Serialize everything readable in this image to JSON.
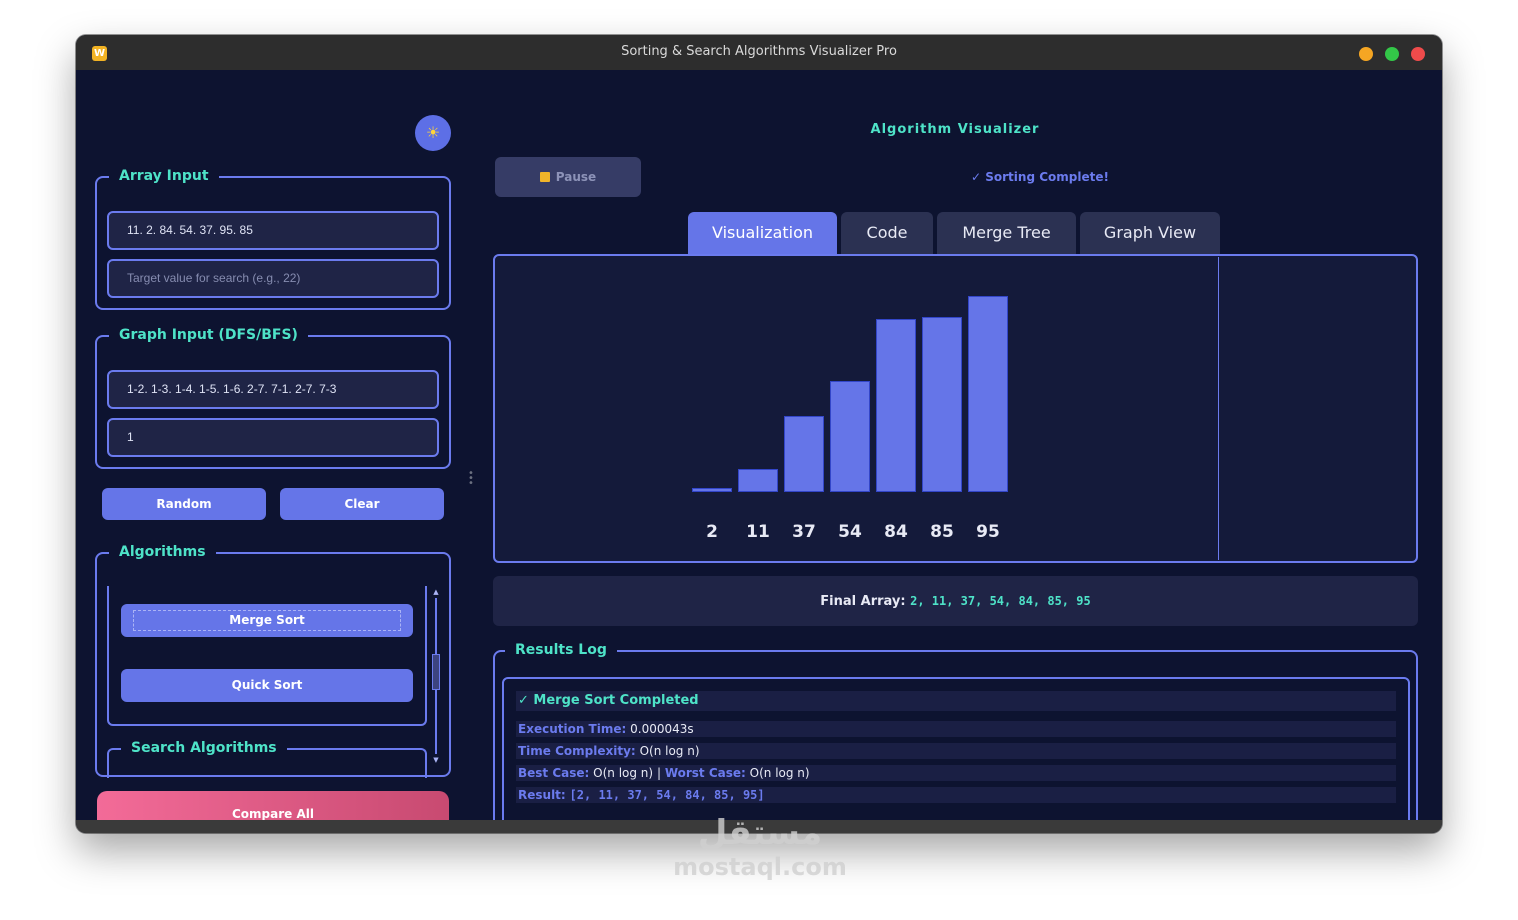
{
  "window": {
    "title": "Sorting & Search Algorithms Visualizer Pro",
    "app_icon_letter": "W"
  },
  "sidebar": {
    "theme_icon": "sun-icon",
    "array_input": {
      "title": "Array Input",
      "array_value": "11. 2. 84. 54. 37. 95. 85",
      "target_placeholder": "Target value for search (e.g., 22)"
    },
    "graph_input": {
      "title": "Graph Input (DFS/BFS)",
      "edges_value": "1-2. 1-3. 1-4. 1-5. 1-6. 2-7. 7-1. 2-7. 7-3",
      "start_value": "1"
    },
    "random_label": "Random",
    "clear_label": "Clear",
    "algorithms": {
      "title": "Algorithms",
      "items": [
        "Merge Sort",
        "Quick Sort"
      ],
      "search_title": "Search Algorithms"
    },
    "compare_label": "Compare All"
  },
  "main": {
    "title": "Algorithm Visualizer",
    "pause_label": "Pause",
    "status": "✓ Sorting Complete!",
    "tabs": [
      "Visualization",
      "Code",
      "Merge Tree",
      "Graph View"
    ],
    "active_tab": "Visualization",
    "final_label": "Final Array:",
    "final_values": "2, 11, 37, 54, 84, 85, 95"
  },
  "chart_data": {
    "type": "bar",
    "categories": [
      "2",
      "11",
      "37",
      "54",
      "84",
      "85",
      "95"
    ],
    "values": [
      2,
      11,
      37,
      54,
      84,
      85,
      95
    ]
  },
  "results": {
    "title": "Results Log",
    "heading": "✓ Merge Sort Completed",
    "execution_label": "Execution Time:",
    "execution_value": "0.000043s",
    "complexity_label": "Time Complexity:",
    "complexity_value": "O(n log n)",
    "best_label": "Best Case:",
    "best_value": "O(n log n)",
    "separator": "|",
    "worst_label": "Worst Case:",
    "worst_value": "O(n log n)",
    "result_label": "Result:",
    "result_value": "[2, 11, 37, 54, 84, 85, 95]"
  },
  "watermark": {
    "arabic": "مستقل",
    "latin": "mostaql.com"
  },
  "colors": {
    "accent": "#6575e8",
    "teal": "#4ee3c8",
    "background": "#0d1330",
    "compare_gradient_start": "#f36b98"
  }
}
